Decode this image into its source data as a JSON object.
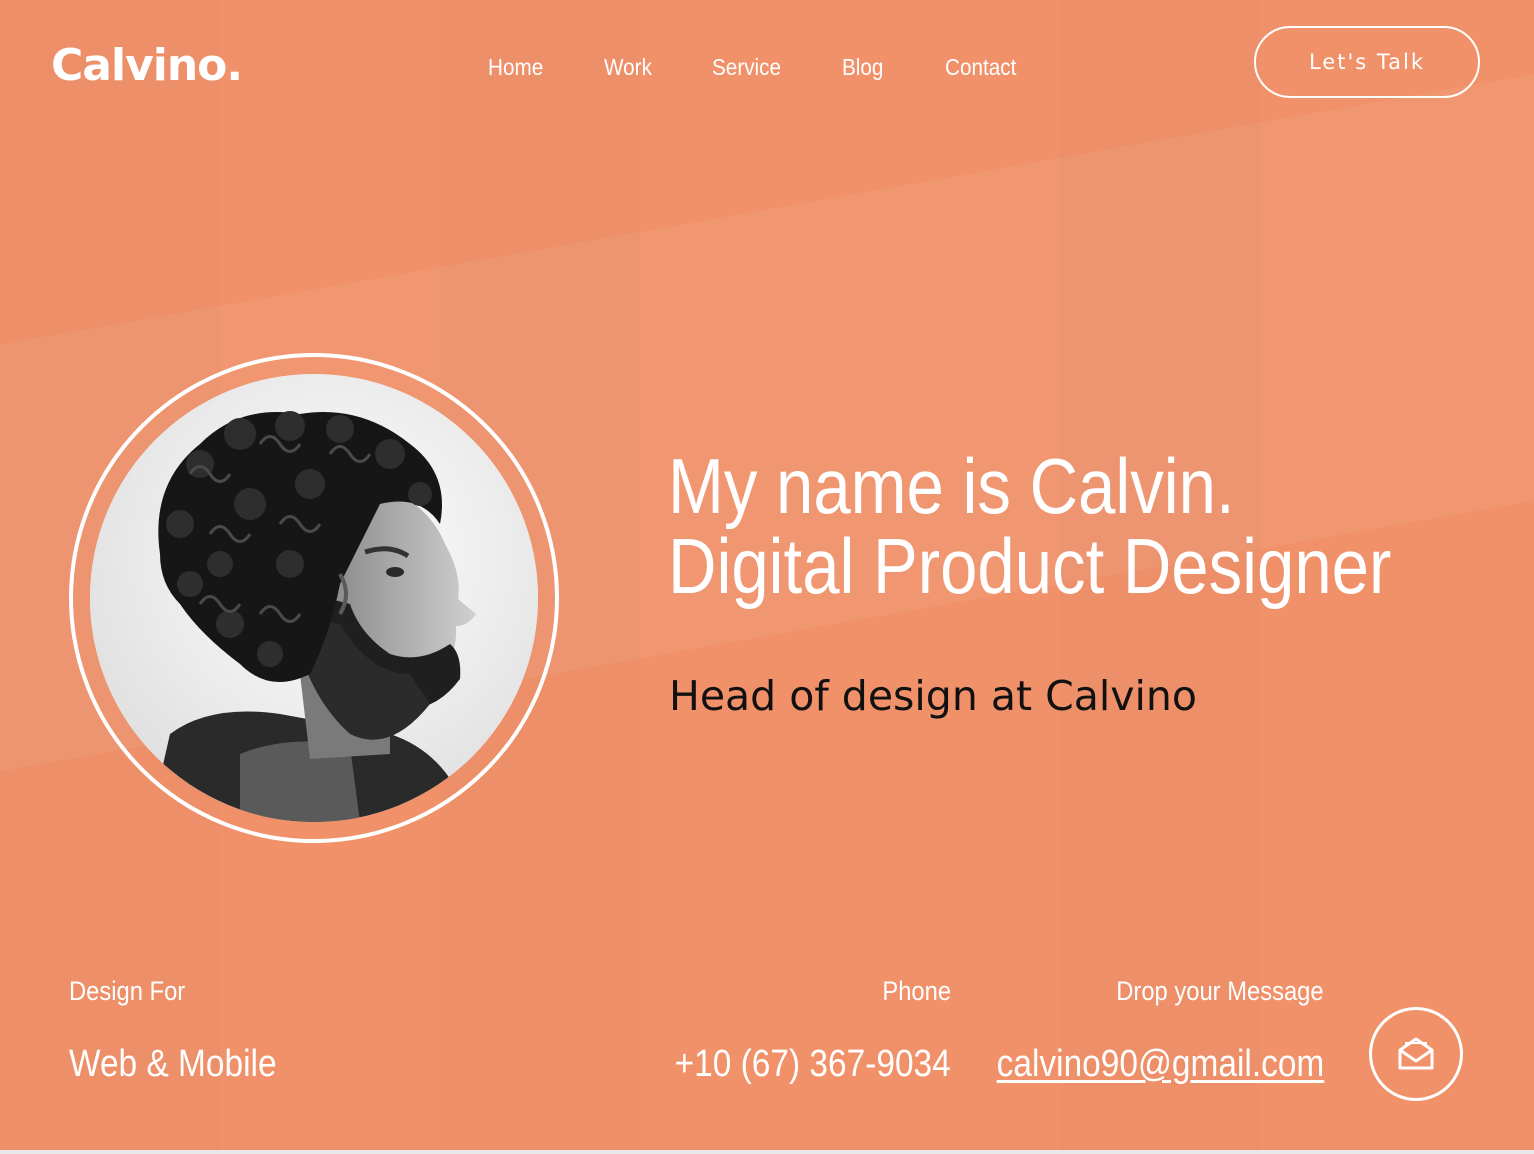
{
  "brand": {
    "logo": "Calvino."
  },
  "nav": {
    "items": [
      {
        "label": "Home"
      },
      {
        "label": "Work"
      },
      {
        "label": "Service"
      },
      {
        "label": "Blog"
      },
      {
        "label": "Contact"
      }
    ],
    "cta_label": "Let's Talk"
  },
  "hero": {
    "headline_line1": "My name is Calvin.",
    "headline_line2": "Digital Product Designer",
    "subtitle": "Head of design at Calvino"
  },
  "info": {
    "design_for_label": "Design For",
    "design_for_value": "Web & Mobile",
    "phone_label": "Phone",
    "phone_value": "+10 (67) 367-9034",
    "message_label": "Drop your Message",
    "email_value": "calvino90@gmail.com"
  },
  "icons": {
    "mail": "mail-open-icon"
  },
  "colors": {
    "background": "#f0916a",
    "text": "#ffffff",
    "subtitle": "#111111"
  }
}
